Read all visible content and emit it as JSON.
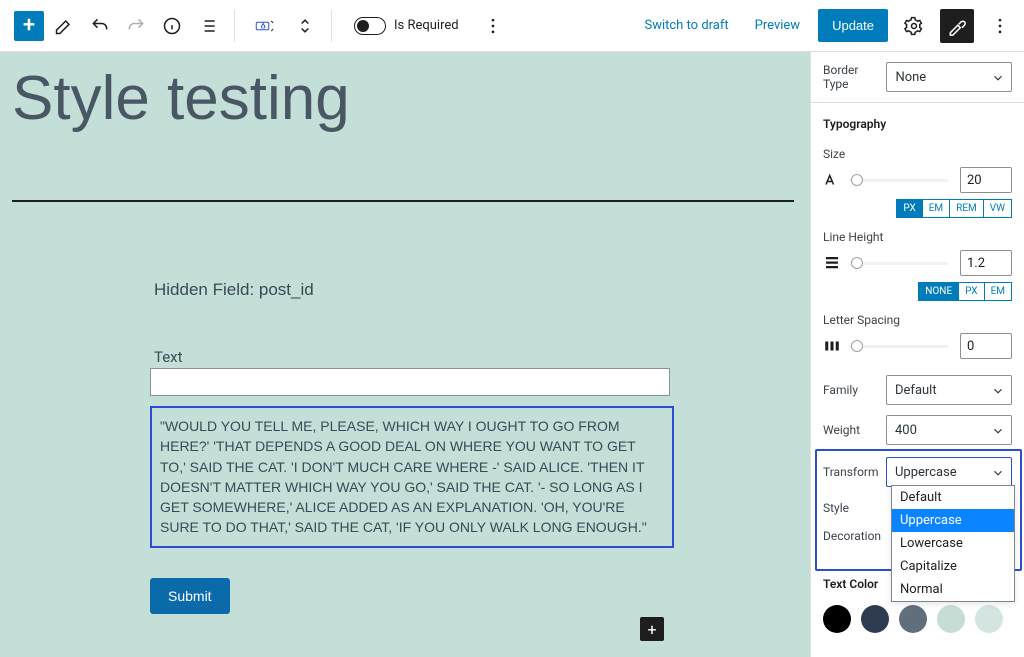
{
  "toolbar": {
    "is_required_label": "Is Required",
    "switch_draft": "Switch to draft",
    "preview": "Preview",
    "update": "Update"
  },
  "canvas": {
    "title": "Style testing",
    "hidden_field_label": "Hidden Field: post_id",
    "text_label": "Text",
    "long_text": "\"WOULD YOU TELL ME, PLEASE, WHICH WAY I OUGHT TO GO FROM HERE?' 'THAT DEPENDS A GOOD DEAL ON WHERE YOU WANT TO GET TO,' SAID THE CAT. 'I DON'T MUCH CARE WHERE -' SAID ALICE. 'THEN IT DOESN'T MATTER WHICH WAY YOU GO,' SAID THE CAT. '- SO LONG AS I GET SOMEWHERE,' ALICE ADDED AS AN EXPLANATION. 'OH, YOU'RE SURE TO DO THAT,' SAID THE CAT, 'IF YOU ONLY WALK LONG ENOUGH.\"",
    "submit": "Submit"
  },
  "sidebar": {
    "border_type_label": "Border Type",
    "border_type_value": "None",
    "typography": "Typography",
    "size_label": "Size",
    "size_value": "20",
    "size_units": [
      "PX",
      "EM",
      "REM",
      "VW"
    ],
    "line_height_label": "Line Height",
    "line_height_value": "1.2",
    "line_height_units": [
      "NONE",
      "PX",
      "EM"
    ],
    "letter_spacing_label": "Letter Spacing",
    "letter_spacing_value": "0",
    "family_label": "Family",
    "family_value": "Default",
    "weight_label": "Weight",
    "weight_value": "400",
    "transform_label": "Transform",
    "transform_value": "Uppercase",
    "transform_options": [
      "Default",
      "Uppercase",
      "Lowercase",
      "Capitalize",
      "Normal"
    ],
    "style_label": "Style",
    "decoration_label": "Decoration",
    "text_color_label": "Text Color",
    "text_colors": [
      "#000000",
      "#2e3c52",
      "#616e7e",
      "#c6ddd5",
      "#d2e5e0"
    ]
  }
}
